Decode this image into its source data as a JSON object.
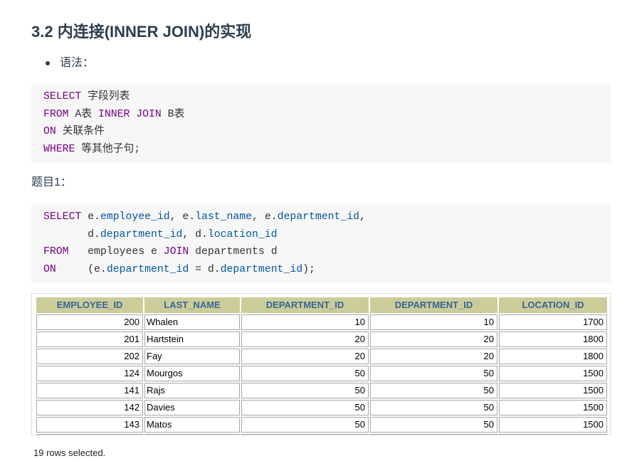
{
  "heading": "3.2 内连接(INNER JOIN)的实现",
  "syntax_label": "语法：",
  "syntax_code": {
    "lines": [
      [
        {
          "keyword": "SELECT"
        },
        {
          "plain": " 字段列表"
        }
      ],
      [
        {
          "keyword": "FROM"
        },
        {
          "plain": " A表 "
        },
        {
          "keyword": "INNER JOIN"
        },
        {
          "plain": " B表"
        }
      ],
      [
        {
          "keyword": "ON"
        },
        {
          "plain": " 关联条件"
        }
      ],
      [
        {
          "keyword": "WHERE"
        },
        {
          "plain": " 等其他子句;"
        }
      ]
    ]
  },
  "question_label": "题目1：",
  "query_code": {
    "lines": [
      [
        {
          "keyword": "SELECT"
        },
        {
          "plain": " e."
        },
        {
          "property": "employee_id"
        },
        {
          "plain": ", e."
        },
        {
          "property": "last_name"
        },
        {
          "plain": ", e."
        },
        {
          "property": "department_id"
        },
        {
          "plain": ","
        }
      ],
      [
        {
          "plain": "       d."
        },
        {
          "property": "department_id"
        },
        {
          "plain": ", d."
        },
        {
          "property": "location_id"
        }
      ],
      [
        {
          "keyword": "FROM"
        },
        {
          "plain": "   employees e "
        },
        {
          "keyword": "JOIN"
        },
        {
          "plain": " departments d"
        }
      ],
      [
        {
          "keyword": "ON"
        },
        {
          "plain": "     (e."
        },
        {
          "property": "department_id"
        },
        {
          "plain": " = d."
        },
        {
          "property": "department_id"
        },
        {
          "plain": ");"
        }
      ]
    ]
  },
  "result": {
    "columns": [
      "EMPLOYEE_ID",
      "LAST_NAME",
      "DEPARTMENT_ID",
      "DEPARTMENT_ID",
      "LOCATION_ID"
    ],
    "rows": [
      [
        "200",
        "Whalen",
        "10",
        "10",
        "1700"
      ],
      [
        "201",
        "Hartstein",
        "20",
        "20",
        "1800"
      ],
      [
        "202",
        "Fay",
        "20",
        "20",
        "1800"
      ],
      [
        "124",
        "Mourgos",
        "50",
        "50",
        "1500"
      ],
      [
        "141",
        "Rajs",
        "50",
        "50",
        "1500"
      ],
      [
        "142",
        "Davies",
        "50",
        "50",
        "1500"
      ],
      [
        "143",
        "Matos",
        "50",
        "50",
        "1500"
      ]
    ],
    "footer": "19 rows selected."
  },
  "colors": {
    "heading": "#2c3e50",
    "body_text": "#2c3e50",
    "code_text": "#333333",
    "keyword": "#770088",
    "property": "#0055aa",
    "code_bg": "#f7f7f7",
    "table_header_bg": "#cccc99",
    "table_header_text": "#336699"
  }
}
